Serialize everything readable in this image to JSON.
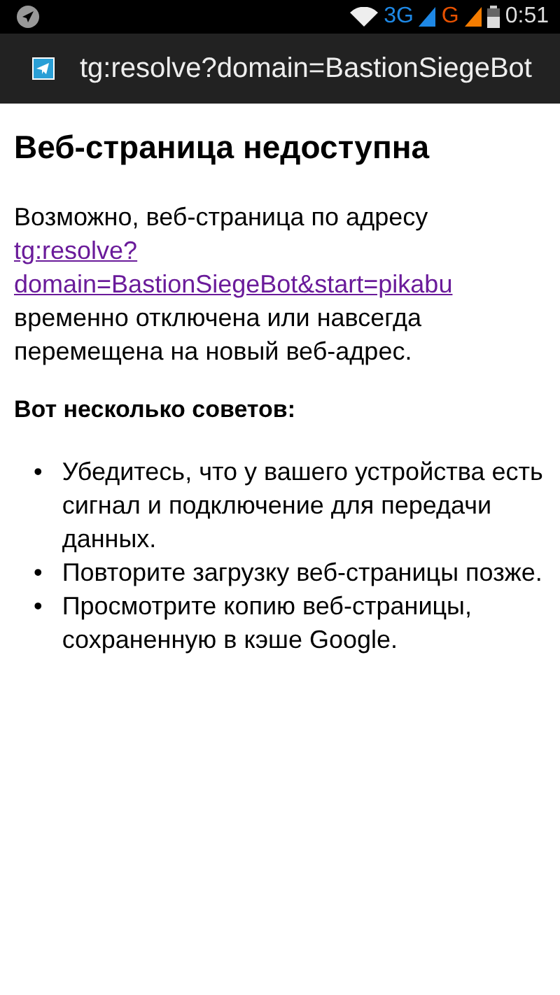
{
  "status_bar": {
    "network_3g": "3G",
    "network_g": "G",
    "time": "0:51"
  },
  "address_bar": {
    "url": "tg:resolve?domain=BastionSiegeBot"
  },
  "page": {
    "heading": "Веб-страница недоступна",
    "intro": "Возможно, веб-страница по адресу",
    "link": "tg:resolve?domain=BastionSiegeBot&start=pikabu",
    "after_link": "временно отключена или навсегда перемещена на новый веб-адрес.",
    "tips_title": "Вот несколько советов:",
    "tips": [
      {
        "marker": "•",
        "text": "Убедитесь, что у вашего устройства есть сигнал и подключение для передачи данных."
      },
      {
        "marker": "•",
        "text": "Повторите загрузку веб-страницы позже."
      },
      {
        "marker": "•",
        "text": "Просмотрите копию веб-страницы, сохраненную в кэше Google."
      }
    ]
  }
}
